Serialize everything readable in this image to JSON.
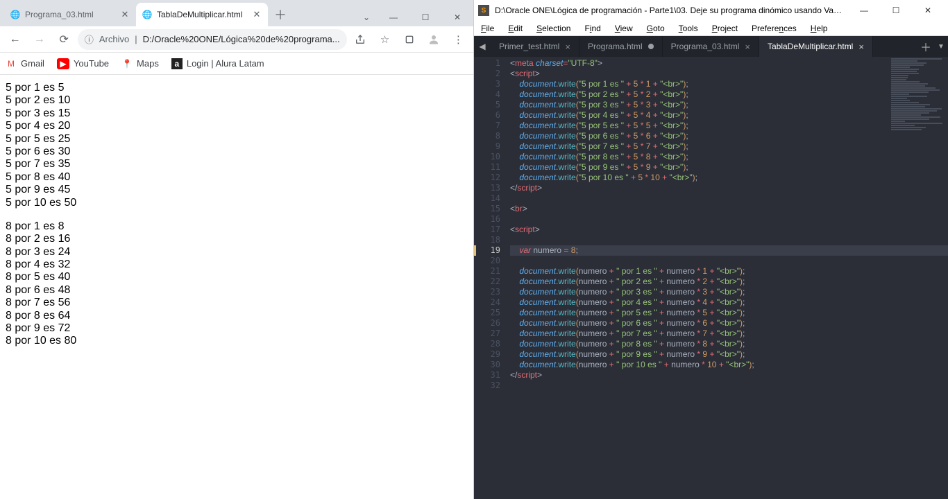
{
  "chrome": {
    "tabs": [
      {
        "title": "Programa_03.html",
        "active": false
      },
      {
        "title": "TablaDeMultiplicar.html",
        "active": true
      }
    ],
    "omnibox_label": "Archivo",
    "omnibox_url": "D:/Oracle%20ONE/Lógica%20de%20programa...",
    "bookmarks": [
      {
        "label": "Gmail"
      },
      {
        "label": "YouTube"
      },
      {
        "label": "Maps"
      },
      {
        "label": "Login | Alura Latam"
      }
    ],
    "content": {
      "block5": [
        "5 por 1 es 5",
        "5 por 2 es 10",
        "5 por 3 es 15",
        "5 por 4 es 20",
        "5 por 5 es 25",
        "5 por 6 es 30",
        "5 por 7 es 35",
        "5 por 8 es 40",
        "5 por 9 es 45",
        "5 por 10 es 50"
      ],
      "block8": [
        "8 por 1 es 8",
        "8 por 2 es 16",
        "8 por 3 es 24",
        "8 por 4 es 32",
        "8 por 5 es 40",
        "8 por 6 es 48",
        "8 por 7 es 56",
        "8 por 8 es 64",
        "8 por 9 es 72",
        "8 por 10 es 80"
      ]
    }
  },
  "sublime": {
    "title": "D:\\Oracle ONE\\Lógica de programación - Parte1\\03. Deje su programa dinómico usando Variab...",
    "menu": [
      "File",
      "Edit",
      "Selection",
      "Find",
      "View",
      "Goto",
      "Tools",
      "Project",
      "Preferences",
      "Help"
    ],
    "tabs": [
      {
        "title": "Primer_test.html",
        "close": true
      },
      {
        "title": "Programa.html",
        "dirty": true
      },
      {
        "title": "Programa_03.html",
        "close": true
      },
      {
        "title": "TablaDeMultiplicar.html",
        "active": true,
        "close": true
      }
    ],
    "current_line": 19,
    "code": {
      "meta_charset": "UTF-8",
      "block1": [
        {
          "n": 1
        },
        {
          "n": 2
        },
        {
          "n": 3
        },
        {
          "n": 4
        },
        {
          "n": 5
        },
        {
          "n": 6
        },
        {
          "n": 7
        },
        {
          "n": 8
        },
        {
          "n": 9
        },
        {
          "n": 10
        }
      ],
      "var_name": "numero",
      "var_value": 8,
      "block2": [
        {
          "n": 1
        },
        {
          "n": 2
        },
        {
          "n": 3
        },
        {
          "n": 4
        },
        {
          "n": 5
        },
        {
          "n": 6
        },
        {
          "n": 7
        },
        {
          "n": 8
        },
        {
          "n": 9
        },
        {
          "n": 10
        }
      ]
    }
  }
}
